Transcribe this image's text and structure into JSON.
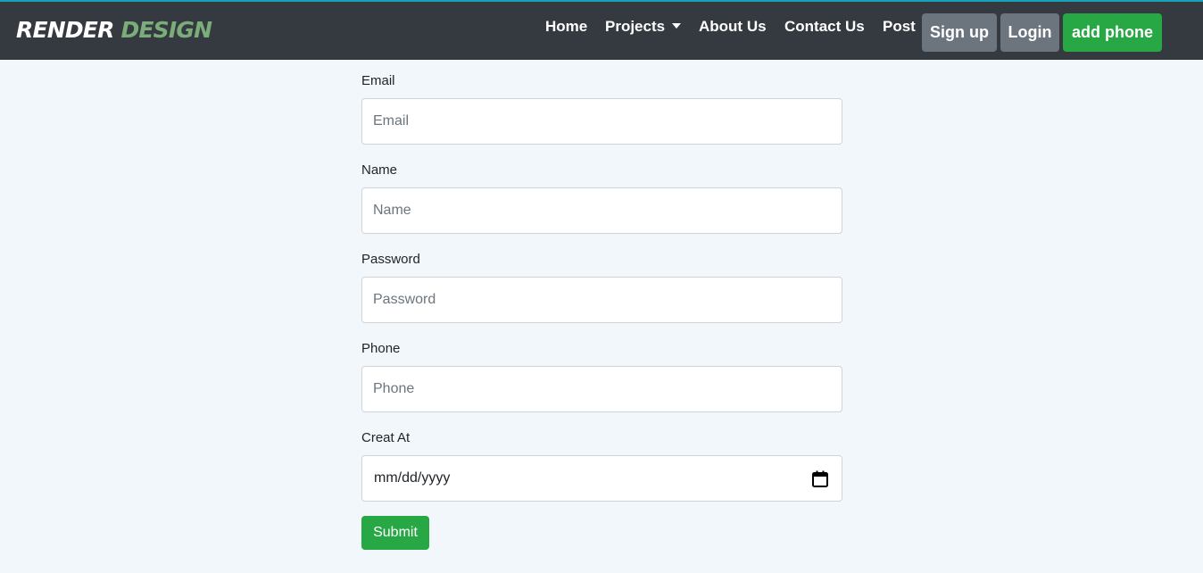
{
  "brand": {
    "part1": "RENDER",
    "part2": "DESIGN"
  },
  "nav": {
    "home": "Home",
    "projects": "Projects",
    "about": "About Us",
    "contact": "Contact Us",
    "post": "Post",
    "signup": "Sign up",
    "login": "Login",
    "add_phone": "add phone"
  },
  "form": {
    "email": {
      "label": "Email",
      "placeholder": "Email",
      "value": ""
    },
    "name": {
      "label": "Name",
      "placeholder": "Name",
      "value": ""
    },
    "password": {
      "label": "Password",
      "placeholder": "Password",
      "value": ""
    },
    "phone": {
      "label": "Phone",
      "placeholder": "Phone",
      "value": ""
    },
    "created_at": {
      "label": "Creat At",
      "placeholder": "mm/dd/yyyy",
      "icon": "calendar-icon"
    },
    "submit": "Submit"
  },
  "colors": {
    "navbar_bg": "#343a40",
    "brand_accent": "#7aad7a",
    "secondary_button": "#6c757d",
    "success_button": "#28a745",
    "page_bg": "#f2f7fb"
  }
}
